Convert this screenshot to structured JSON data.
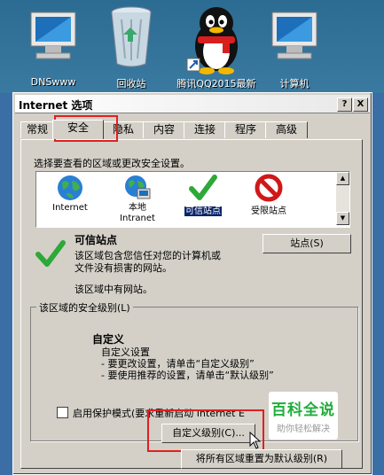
{
  "desktop": {
    "icons": [
      {
        "label": "DNSwww",
        "icon": "computer-icon"
      },
      {
        "label": "回收站",
        "icon": "recycle-bin-icon"
      },
      {
        "label": "腾讯QQ2015最新",
        "icon": "qq-penguin-icon"
      },
      {
        "label": "计算机",
        "icon": "computer-icon"
      }
    ]
  },
  "window": {
    "title": "Internet 选项",
    "help_label": "?",
    "close_label": "X",
    "tabs": [
      "常规",
      "安全",
      "隐私",
      "内容",
      "连接",
      "程序",
      "高级"
    ],
    "active_tab": "安全",
    "zone_prompt": "选择要查看的区域或更改安全设置。",
    "zones": [
      {
        "label": "Internet",
        "icon": "globe-icon"
      },
      {
        "label": "本地\nIntranet",
        "icon": "intranet-icon"
      },
      {
        "label": "可信站点",
        "icon": "checkmark-icon"
      },
      {
        "label": "受限站点",
        "icon": "no-entry-icon"
      }
    ],
    "selected_zone": "可信站点",
    "zone_title": "可信站点",
    "zone_desc": "该区域包含您信任对您的计算机或\n文件没有损害的网站。",
    "zone_status": "该区域中有网站。",
    "sites_button": "站点(S)",
    "level_group_label": "该区域的安全级别(L)",
    "level_title": "自定义",
    "level_lines": [
      "自定义设置",
      "- 要更改设置，请单击“自定义级别”",
      "- 要使用推荐的设置，请单击“默认级别”"
    ],
    "protected_mode_label": "启用保护模式(要求重新启动 Internet E",
    "custom_level_button": "自定义级别(C)...",
    "reset_all_button": "将所有区域重置为默认级别(R)"
  },
  "watermark": {
    "title": "百科全说",
    "subtitle": "助你轻松解决"
  },
  "colors": {
    "highlight": "#e02020",
    "selection": "#0a246a",
    "dialog": "#d4d0c8"
  }
}
